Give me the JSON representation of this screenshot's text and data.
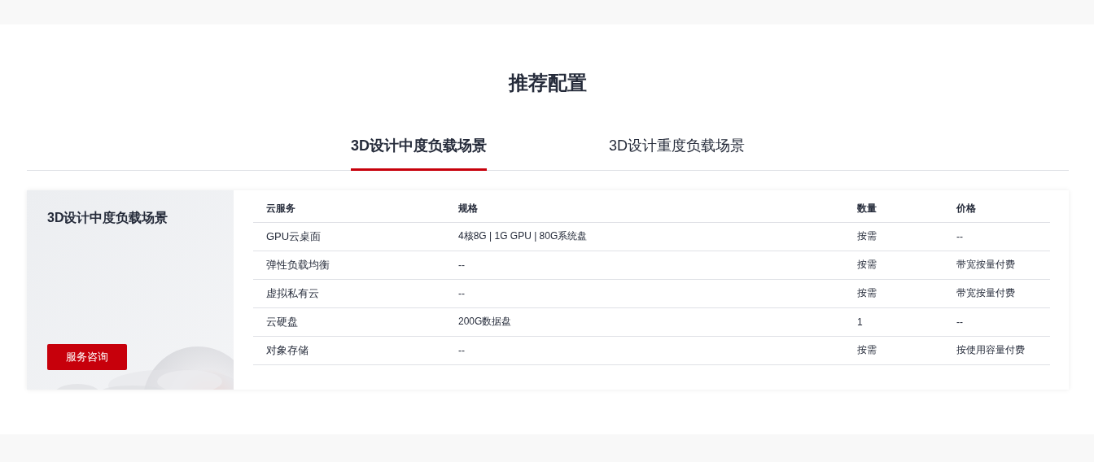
{
  "title": "推荐配置",
  "tabs": [
    {
      "label": "3D设计中度负载场景",
      "selected": true
    },
    {
      "label": "3D设计重度负载场景",
      "selected": false
    }
  ],
  "panel": {
    "title": "3D设计中度负载场景",
    "button": "服务咨询",
    "kind": "picture"
  },
  "table": {
    "columns": [
      "云服务",
      "规格",
      "数量",
      "价格"
    ],
    "rows": [
      [
        "GPU云桌面",
        "4核8G | 1G GPU | 80G系统盘",
        "按需",
        "--"
      ],
      [
        "弹性负载均衡",
        "--",
        "按需",
        "带宽按量付费"
      ],
      [
        "虚拟私有云",
        "--",
        "按需",
        "带宽按量付费"
      ],
      [
        "云硬盘",
        "200G数据盘",
        "1",
        "--"
      ],
      [
        "对象存储",
        "--",
        "按需",
        "按使用容量付费"
      ]
    ]
  }
}
